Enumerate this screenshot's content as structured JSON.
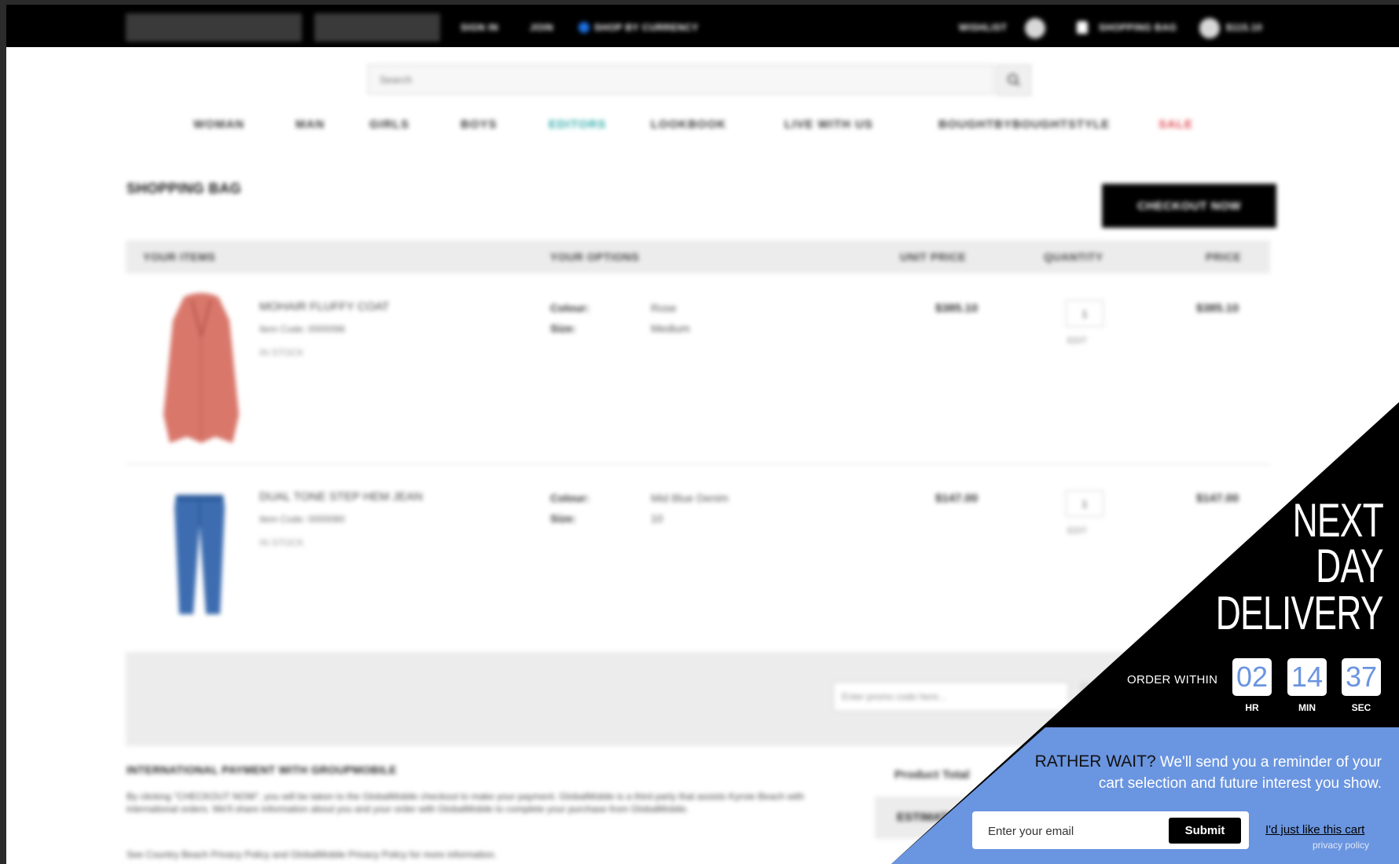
{
  "topbar": {
    "items": [
      "SIGN IN",
      "JOIN",
      "SHOP BY CURRENCY",
      "WISHLIST",
      "SHOPPING BAG",
      "$115.10"
    ]
  },
  "search": {
    "placeholder": "Search"
  },
  "nav": {
    "items": [
      "WOMAN",
      "MAN",
      "GIRLS",
      "BOYS",
      "EDITORS",
      "LOOKBOOK",
      "LIVE WITH US",
      "BOUGHTBYBOUGHTSTYLE",
      "SALE"
    ]
  },
  "bag": {
    "title": "SHOPPING BAG",
    "checkout_label": "CHECKOUT NOW",
    "columns": [
      "YOUR ITEMS",
      "YOUR OPTIONS",
      "UNIT PRICE",
      "QUANTITY",
      "PRICE"
    ],
    "items": [
      {
        "name": "MOHAIR FLUFFY COAT",
        "ref": "Item Code: 0000098",
        "stock": "IN STOCK",
        "options": [
          {
            "label": "Colour:",
            "value": "Rose"
          },
          {
            "label": "Size:",
            "value": "Medium"
          }
        ],
        "unit_price": "$385.10",
        "qty": "1",
        "qty_action": "EDIT",
        "price": "$385.10"
      },
      {
        "name": "DUAL TONE STEP HEM JEAN",
        "ref": "Item Code: 0000080",
        "stock": "IN STOCK",
        "options": [
          {
            "label": "Colour:",
            "value": "Mid Blue Denim"
          },
          {
            "label": "Size:",
            "value": "10"
          }
        ],
        "unit_price": "$147.00",
        "qty": "1",
        "qty_action": "EDIT",
        "price": "$147.00"
      }
    ],
    "promo_placeholder": "Enter promo code here...",
    "intl_heading": "INTERNATIONAL PAYMENT WITH GROUPMOBILE",
    "intl_paragraphs": [
      "By clicking \"CHECKOUT NOW\", you will be taken to the GlobalMobile checkout to make your payment. GlobalMobile is a third party that assists Kyroie Beach with international orders. We'll share information about you and your order with GlobalMobile to complete your purchase from GlobalMobile.",
      "See Country Beach Privacy Policy and GlobalMobile Privacy Policy for more information."
    ],
    "summary_label": "Product Total",
    "summary_box_label": "ESTIMATED TOTAL"
  },
  "promo_overlay": {
    "headline": [
      "NEXT",
      "DAY",
      "DELIVERY"
    ],
    "order_within": "ORDER WITHIN",
    "countdown": [
      {
        "value": "02",
        "unit": "HR"
      },
      {
        "value": "14",
        "unit": "MIN"
      },
      {
        "value": "37",
        "unit": "SEC"
      }
    ],
    "rather_wait": "RATHER WAIT?",
    "reminder_text": "We'll send you a reminder of your cart selection and future interest you show.",
    "email_placeholder": "Enter your email",
    "submit_label": "Submit",
    "decline_label": "I'd just like this cart",
    "privacy_label": "privacy policy",
    "colors": {
      "black": "#000000",
      "blue": "#6a95e0"
    }
  }
}
